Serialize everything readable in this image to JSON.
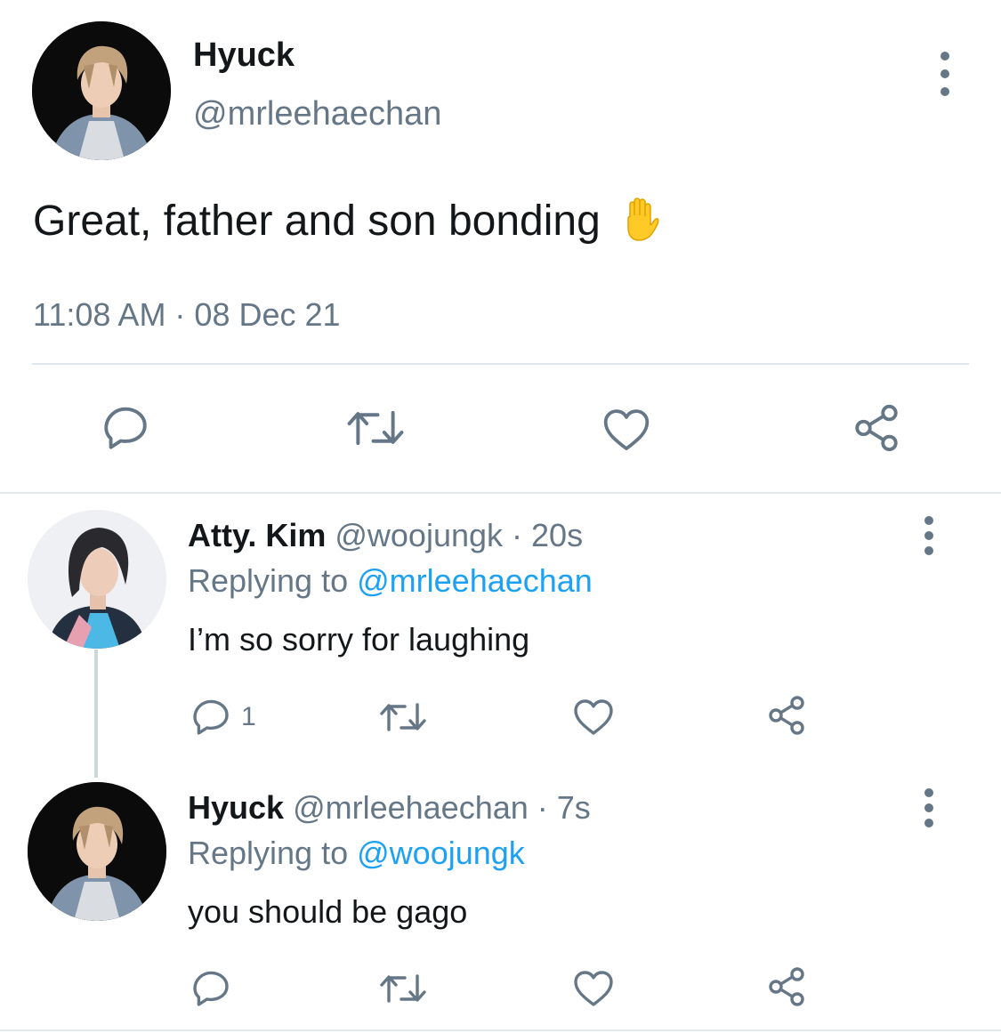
{
  "main_tweet": {
    "display_name": "Hyuck",
    "handle": "@mrleehaechan",
    "text": "Great, father and son bonding",
    "emoji": "✋",
    "timestamp": "11:08 AM · 08 Dec 21",
    "actions": [
      "reply-icon",
      "retweet-icon",
      "like-icon",
      "share-icon"
    ]
  },
  "replies": [
    {
      "display_name": "Atty. Kim",
      "handle": "@woojungk",
      "time": "· 20s",
      "replying_prefix": "Replying to",
      "replying_to": "@mrleehaechan",
      "text": "I’m so sorry for laughing",
      "reply_count": "1"
    },
    {
      "display_name": "Hyuck",
      "handle": "@mrleehaechan",
      "time": "· 7s",
      "replying_prefix": "Replying to",
      "replying_to": "@woojungk",
      "text": "you should be gago",
      "reply_count": ""
    }
  ],
  "colors": {
    "text": "#14171a",
    "secondary": "#657786",
    "link": "#1da1f2",
    "divider": "#e1e8ed"
  }
}
